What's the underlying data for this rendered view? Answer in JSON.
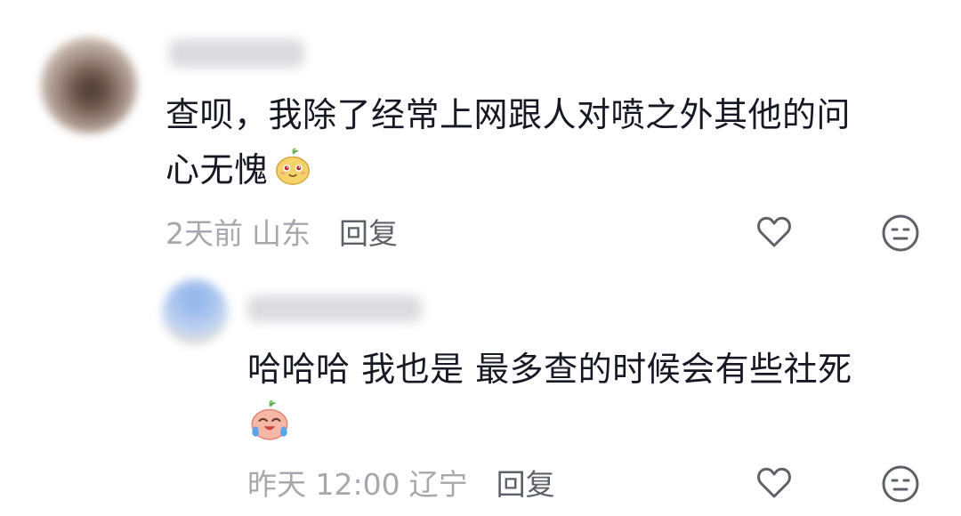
{
  "comment": {
    "text_line1": "查呗，我除了经常上网跟人对喷之外其他的问",
    "text_line2": "心无愧",
    "emoji_icon": "blush-bun-emoji",
    "time": "2天前",
    "location": "山东",
    "reply_label": "回复"
  },
  "reply": {
    "text": "哈哈哈 我也是 最多查的时候会有些社死",
    "emoji_icon": "crying-laughing-bun-emoji",
    "time": "昨天 12:00",
    "location": "辽宁",
    "reply_label": "回复"
  },
  "icons": {
    "like": "heart-icon",
    "dislike": "neutral-face-icon"
  },
  "colors": {
    "text": "#161823",
    "meta": "#a7a8ad",
    "reply_button": "#5f6168",
    "icon": "#5f6168"
  }
}
